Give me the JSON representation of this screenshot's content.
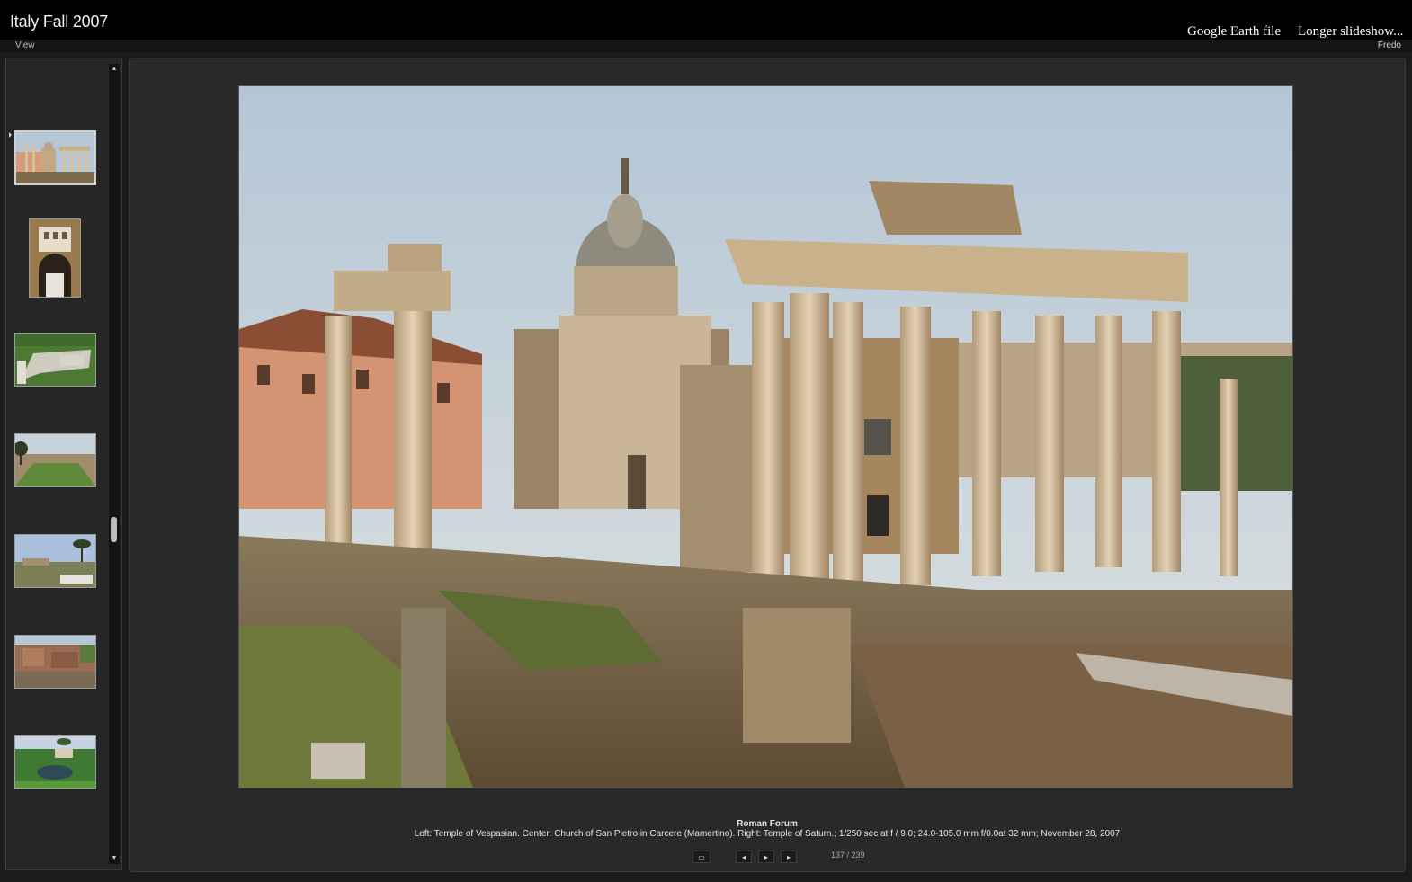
{
  "header": {
    "title": "Italy Fall 2007",
    "view_menu": "View",
    "links": [
      "Google Earth file",
      "Longer slideshow..."
    ],
    "author": "Fredo"
  },
  "filmstrip": {
    "thumbnails": [
      {
        "name": "roman-forum-thumbnail",
        "selected": true
      },
      {
        "name": "archway-thumbnail",
        "selected": false
      },
      {
        "name": "ruins-on-grass-thumbnail",
        "selected": false
      },
      {
        "name": "stadium-field-thumbnail",
        "selected": false
      },
      {
        "name": "pines-landscape-thumbnail",
        "selected": false
      },
      {
        "name": "brick-ruins-thumbnail",
        "selected": false
      },
      {
        "name": "garden-pond-thumbnail",
        "selected": false
      }
    ],
    "scroll_position": 0.57
  },
  "photo": {
    "title": "Roman Forum",
    "description": "Left: Temple of Vespasian. Center: Church of San Pietro in Carcere (Mamertino). Right: Temple of Saturn.; 1/250 sec at f / 9.0;  24.0-105.0 mm f/0.0at 32 mm; November 28, 2007"
  },
  "controls": {
    "screen_icon": "screen-icon",
    "prev_icon": "previous-icon",
    "play_icon": "play-icon",
    "next_icon": "next-icon",
    "counter": "137 / 239"
  },
  "colors": {
    "background": "#1b1b1b",
    "header": "#000000",
    "panel": "#292929"
  }
}
